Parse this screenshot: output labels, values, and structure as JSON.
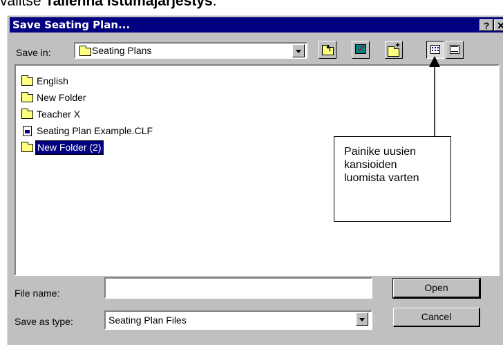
{
  "caption": {
    "prefix": "valitse ",
    "bold": "Tallenna istumajärjestys",
    "suffix": "."
  },
  "dialog": {
    "title": "Save Seating Plan...",
    "help_label": "?",
    "close_label": "✕",
    "save_in_label": "Save in:",
    "save_in_value": "Seating Plans",
    "toolbar": {
      "up_icon": "up-folder-icon",
      "desktop_icon": "desktop-icon",
      "new_folder_icon": "new-folder-icon",
      "list_icon": "list-view-icon",
      "details_icon": "details-view-icon"
    },
    "files": [
      {
        "name": "English",
        "type": "folder"
      },
      {
        "name": "New Folder",
        "type": "folder"
      },
      {
        "name": "Teacher X",
        "type": "folder"
      },
      {
        "name": "Seating Plan Example.CLF",
        "type": "file"
      },
      {
        "name": "New Folder (2)",
        "type": "folder",
        "editing": true
      }
    ],
    "file_name_label": "File name:",
    "file_name_value": "",
    "save_as_type_label": "Save as type:",
    "save_as_type_value": "Seating Plan Files",
    "open_button": "Open",
    "cancel_button": "Cancel"
  },
  "annotation": {
    "lines": [
      "Painike uusien",
      "kansioiden",
      "luomista varten"
    ]
  }
}
